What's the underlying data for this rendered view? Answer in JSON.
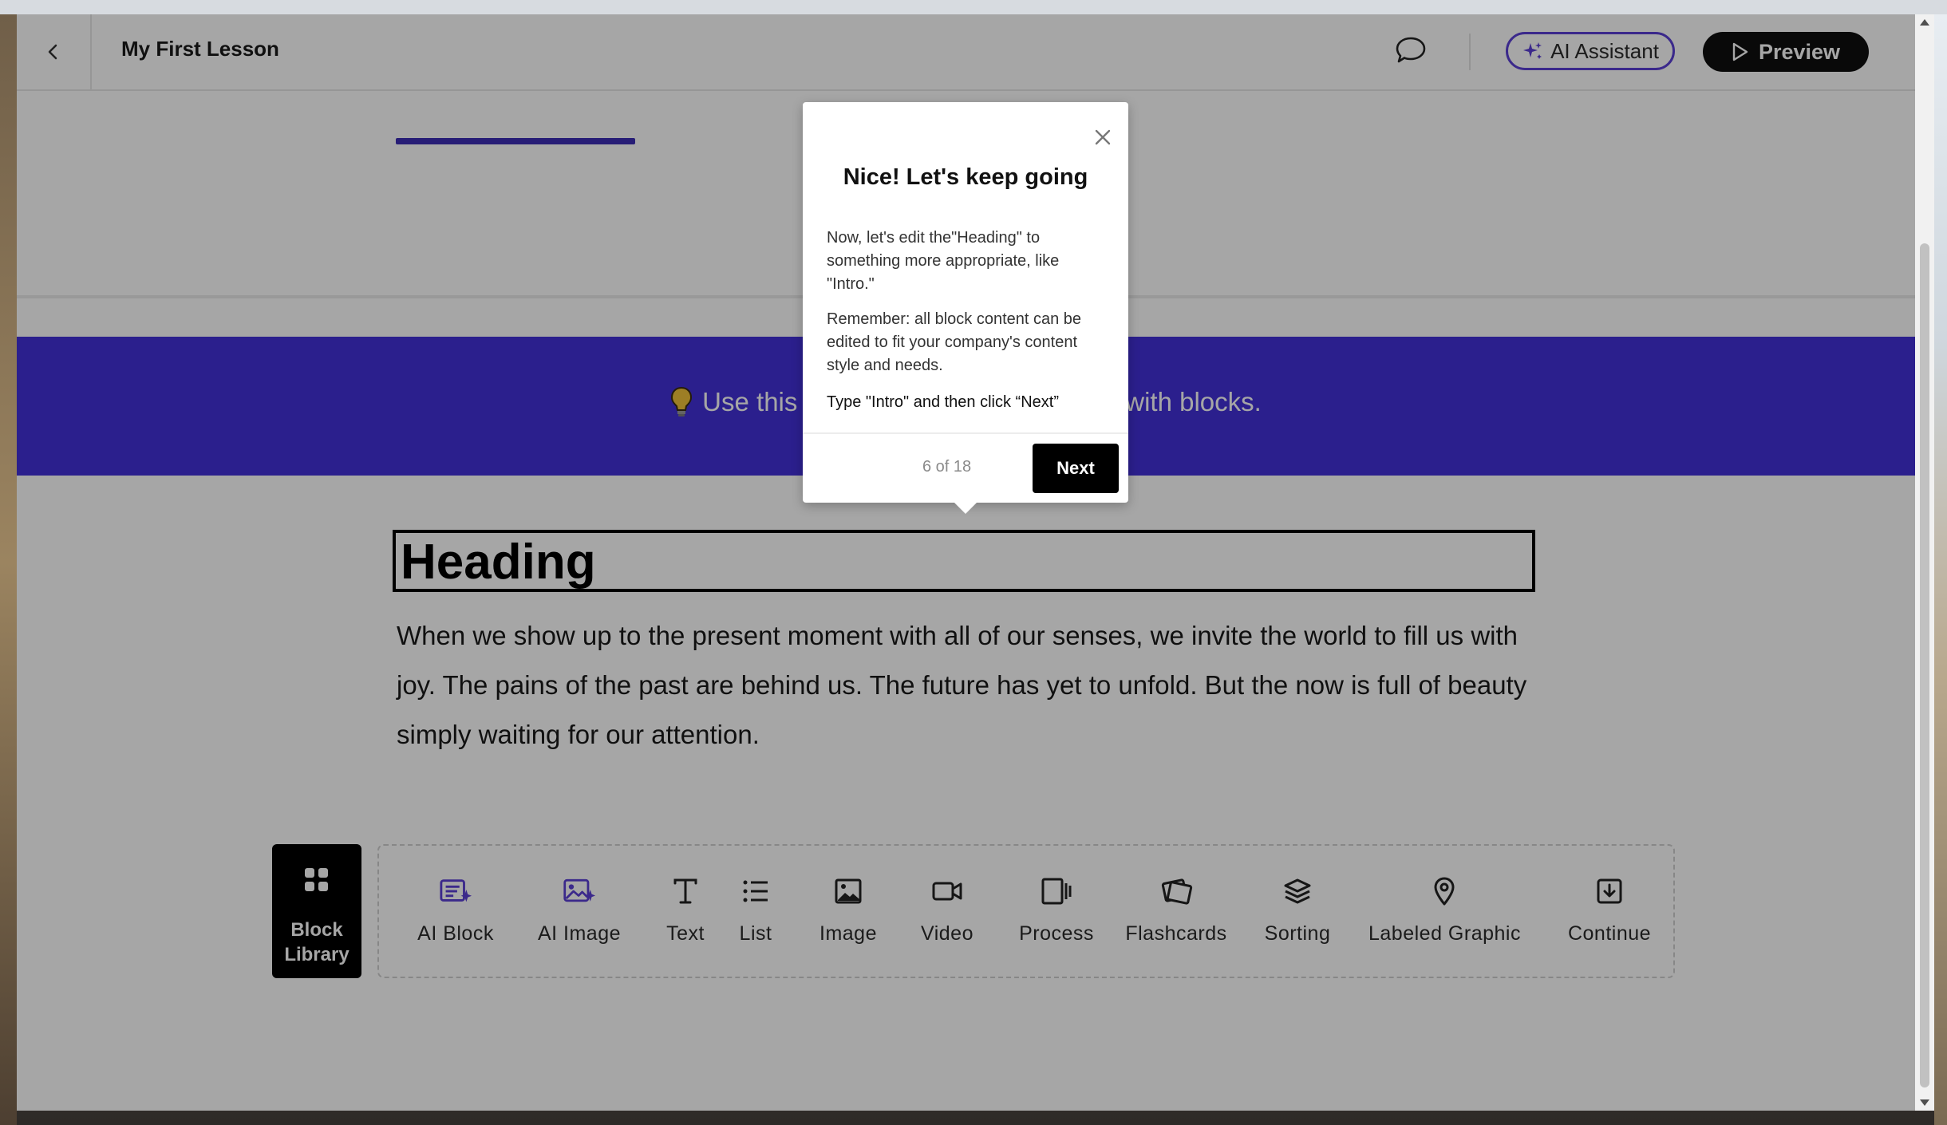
{
  "header": {
    "lesson_title": "My First Lesson",
    "ai_assistant_label": "AI Assistant",
    "preview_label": "Preview"
  },
  "banner": {
    "text": "Use this blank lesson to experiment with blocks."
  },
  "content": {
    "heading": "Heading",
    "body": "When we show up to the present moment with all of our senses, we invite the world to fill us with joy. The pains of the past are behind us. The future has yet to unfold. But the now is full of beauty simply waiting for our attention."
  },
  "block_library": {
    "label": "Block Library"
  },
  "toolbar": {
    "items": [
      {
        "label": "AI Block",
        "icon": "ai-block-icon"
      },
      {
        "label": "AI Image",
        "icon": "ai-image-icon"
      },
      {
        "label": "Text",
        "icon": "text-icon"
      },
      {
        "label": "List",
        "icon": "list-icon"
      },
      {
        "label": "Image",
        "icon": "image-icon"
      },
      {
        "label": "Video",
        "icon": "video-icon"
      },
      {
        "label": "Process",
        "icon": "process-icon"
      },
      {
        "label": "Flashcards",
        "icon": "flashcards-icon"
      },
      {
        "label": "Sorting",
        "icon": "sorting-icon"
      },
      {
        "label": "Labeled Graphic",
        "icon": "location-pin-icon"
      },
      {
        "label": "Continue",
        "icon": "continue-icon"
      }
    ]
  },
  "popover": {
    "title": "Nice! Let's keep going",
    "paragraph1": "Now, let's edit the\"Heading\" to something more appropriate, like \"Intro.\"",
    "paragraph2": "Remember: all block content can be edited to fit your company's content style and needs.",
    "instruction": "Type \"Intro\" and then click “Next”",
    "step": "6 of 18",
    "next_label": "Next"
  },
  "colors": {
    "accent": "#4330d9",
    "ai_purple": "#5b3fd6",
    "dark": "#0f0f0f"
  }
}
